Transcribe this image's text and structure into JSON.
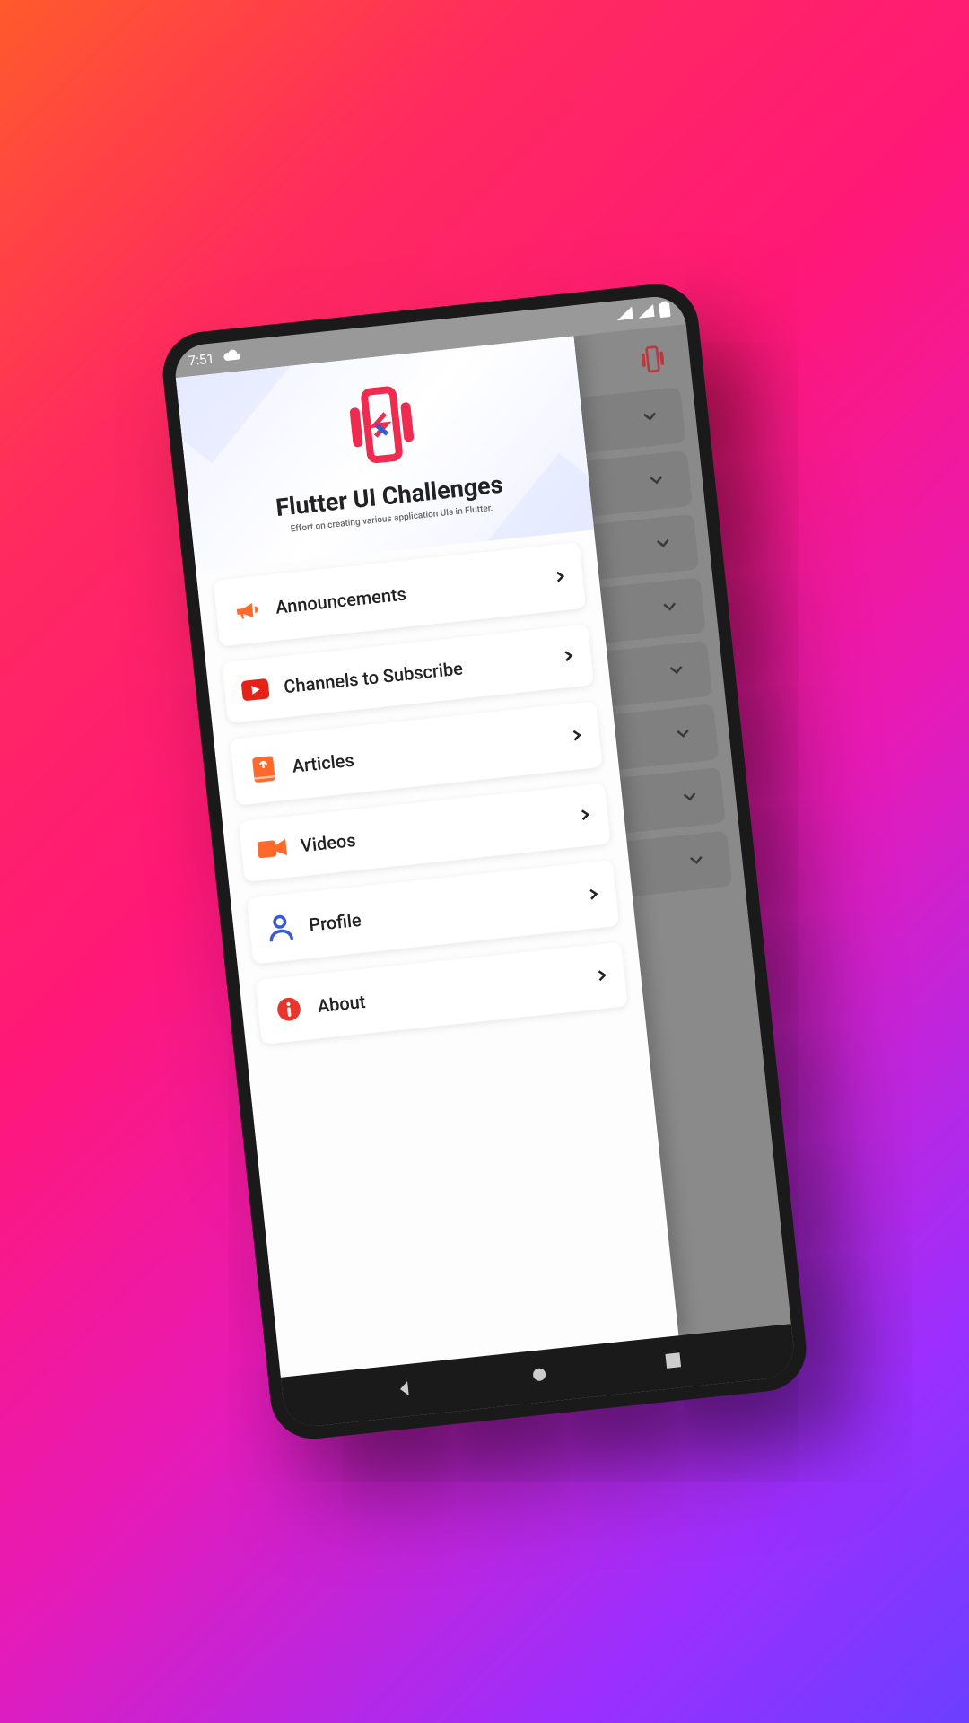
{
  "status": {
    "time": "7:51"
  },
  "header": {
    "title": "Flutter UI Challenges",
    "subtitle": "Effort on creating various application UIs in Flutter."
  },
  "menu": [
    {
      "label": "Announcements",
      "icon": "megaphone",
      "color": "#ff6a2c"
    },
    {
      "label": "Channels to Subscribe",
      "icon": "youtube",
      "color": "#e62117"
    },
    {
      "label": "Articles",
      "icon": "book",
      "color": "#ff6a2c"
    },
    {
      "label": "Videos",
      "icon": "video",
      "color": "#ff6a2c"
    },
    {
      "label": "Profile",
      "icon": "user",
      "color": "#3858d6"
    },
    {
      "label": "About",
      "icon": "info",
      "color": "#e8362f"
    }
  ],
  "back_cards_count": 8
}
